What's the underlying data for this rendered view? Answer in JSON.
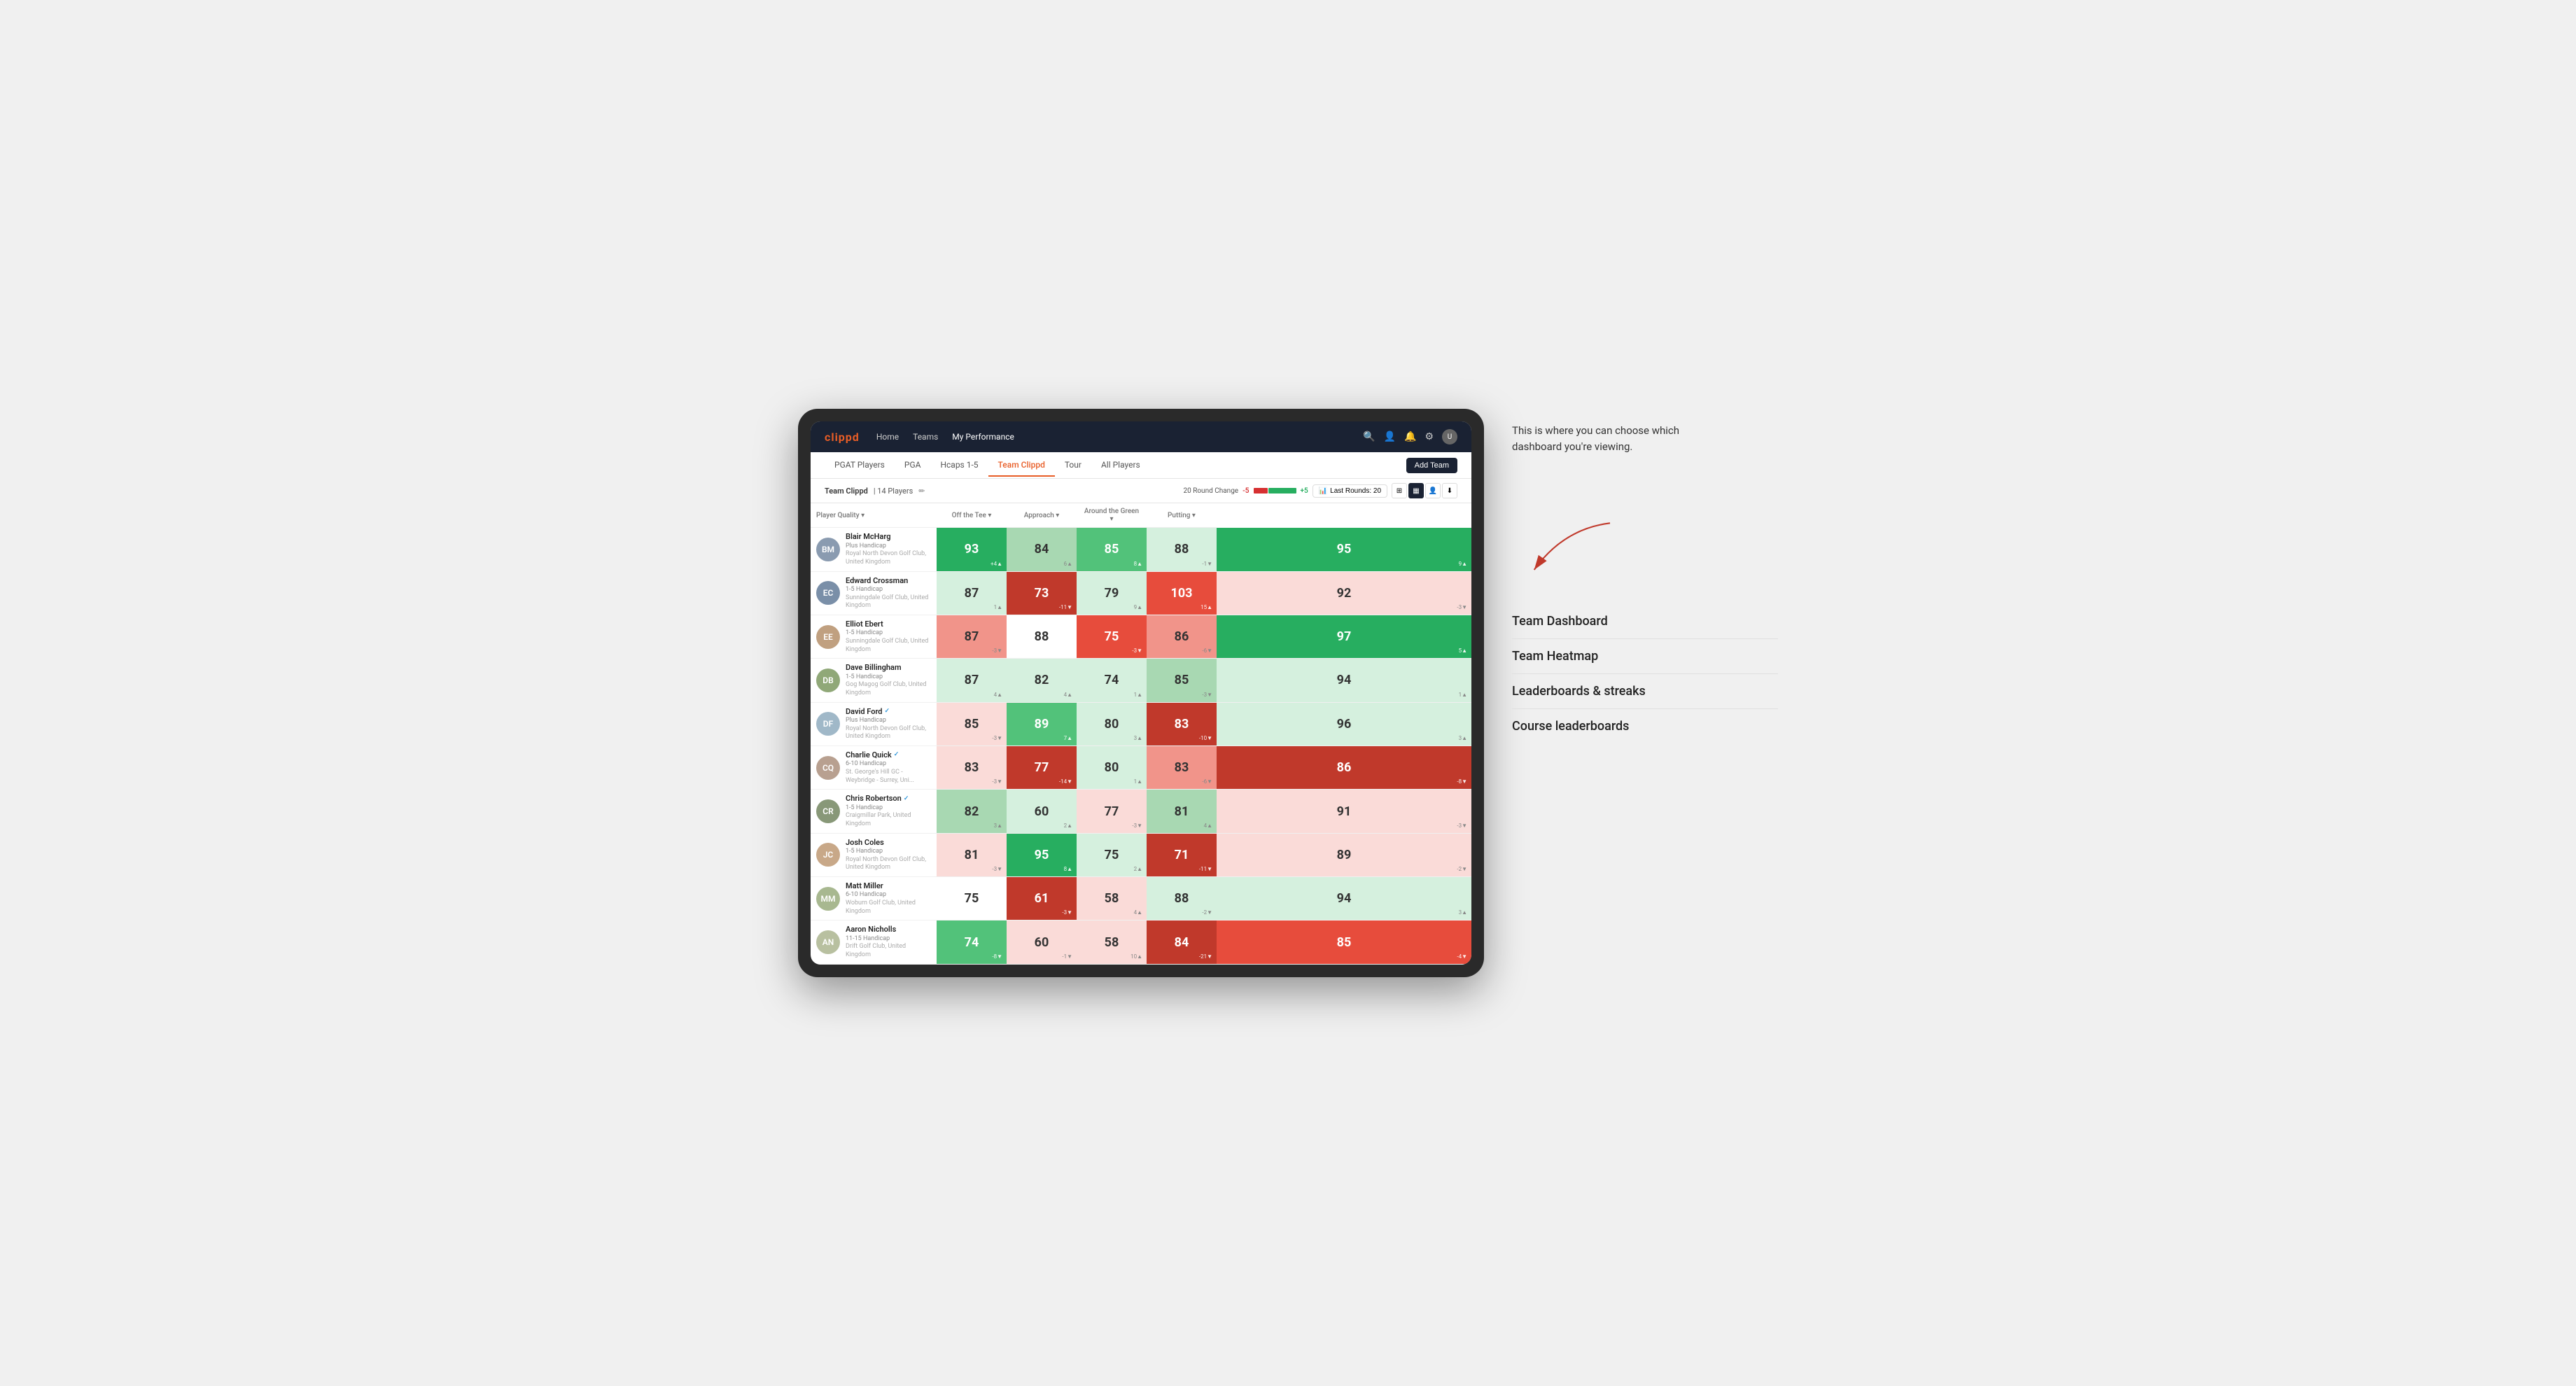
{
  "annotation": {
    "text": "This is where you can choose which dashboard you're viewing.",
    "arrow_label": "arrow pointing to view selector"
  },
  "menu": {
    "items": [
      {
        "id": "team-dashboard",
        "label": "Team Dashboard"
      },
      {
        "id": "team-heatmap",
        "label": "Team Heatmap"
      },
      {
        "id": "leaderboards",
        "label": "Leaderboards & streaks"
      },
      {
        "id": "course-leaderboards",
        "label": "Course leaderboards"
      }
    ]
  },
  "nav": {
    "logo": "clippd",
    "links": [
      {
        "label": "Home",
        "active": false
      },
      {
        "label": "Teams",
        "active": false
      },
      {
        "label": "My Performance",
        "active": true
      }
    ],
    "icons": [
      "search",
      "person",
      "bell",
      "settings",
      "avatar"
    ]
  },
  "sub_nav": {
    "tabs": [
      {
        "label": "PGAT Players",
        "active": false
      },
      {
        "label": "PGA",
        "active": false
      },
      {
        "label": "Hcaps 1-5",
        "active": false
      },
      {
        "label": "Team Clippd",
        "active": true
      },
      {
        "label": "Tour",
        "active": false
      },
      {
        "label": "All Players",
        "active": false
      }
    ],
    "add_team_label": "Add Team"
  },
  "team_bar": {
    "team_name": "Team Clippd",
    "player_count": "14 Players",
    "round_change_label": "20 Round Change",
    "change_neg": "-5",
    "change_pos": "+5",
    "last_rounds_label": "Last Rounds:",
    "last_rounds_value": "20",
    "view_modes": [
      "grid",
      "heatmap",
      "person",
      "download"
    ]
  },
  "table": {
    "col_headers": [
      {
        "label": "Player Quality ▾",
        "key": "quality"
      },
      {
        "label": "Off the Tee ▾",
        "key": "tee"
      },
      {
        "label": "Approach ▾",
        "key": "approach"
      },
      {
        "label": "Around the Green ▾",
        "key": "green"
      },
      {
        "label": "Putting ▾",
        "key": "putting"
      }
    ],
    "players": [
      {
        "name": "Blair McHarg",
        "hcp": "Plus Handicap",
        "club": "Royal North Devon Golf Club, United Kingdom",
        "initials": "BM",
        "avatar_color": "#8a9bb0",
        "verified": false,
        "scores": [
          {
            "value": 93,
            "change": "+4",
            "dir": "up",
            "bg": "green-dark"
          },
          {
            "value": 84,
            "change": "6",
            "dir": "up",
            "bg": "green-light"
          },
          {
            "value": 85,
            "change": "8",
            "dir": "up",
            "bg": "green-mid"
          },
          {
            "value": 88,
            "change": "-1",
            "dir": "down",
            "bg": "pale-green"
          },
          {
            "value": 95,
            "change": "9",
            "dir": "up",
            "bg": "green-dark"
          }
        ]
      },
      {
        "name": "Edward Crossman",
        "hcp": "1-5 Handicap",
        "club": "Sunningdale Golf Club, United Kingdom",
        "initials": "EC",
        "avatar_color": "#7a8fa8",
        "verified": false,
        "scores": [
          {
            "value": 87,
            "change": "1",
            "dir": "up",
            "bg": "pale-green"
          },
          {
            "value": 73,
            "change": "-11",
            "dir": "down",
            "bg": "red-dark"
          },
          {
            "value": 79,
            "change": "9",
            "dir": "up",
            "bg": "pale-green"
          },
          {
            "value": 103,
            "change": "15",
            "dir": "up",
            "bg": "red-mid"
          },
          {
            "value": 92,
            "change": "-3",
            "dir": "down",
            "bg": "pale-red"
          }
        ]
      },
      {
        "name": "Elliot Ebert",
        "hcp": "1-5 Handicap",
        "club": "Sunningdale Golf Club, United Kingdom",
        "initials": "EE",
        "avatar_color": "#c0a080",
        "verified": false,
        "scores": [
          {
            "value": 87,
            "change": "-3",
            "dir": "down",
            "bg": "red-light"
          },
          {
            "value": 88,
            "change": "",
            "dir": "",
            "bg": "white"
          },
          {
            "value": 75,
            "change": "-3",
            "dir": "down",
            "bg": "red-mid"
          },
          {
            "value": 86,
            "change": "-6",
            "dir": "down",
            "bg": "red-light"
          },
          {
            "value": 97,
            "change": "5",
            "dir": "up",
            "bg": "green-dark"
          }
        ]
      },
      {
        "name": "Dave Billingham",
        "hcp": "1-5 Handicap",
        "club": "Gog Magog Golf Club, United Kingdom",
        "initials": "DB",
        "avatar_color": "#90a878",
        "verified": false,
        "scores": [
          {
            "value": 87,
            "change": "4",
            "dir": "up",
            "bg": "pale-green"
          },
          {
            "value": 82,
            "change": "4",
            "dir": "up",
            "bg": "pale-green"
          },
          {
            "value": 74,
            "change": "1",
            "dir": "up",
            "bg": "pale-green"
          },
          {
            "value": 85,
            "change": "-3",
            "dir": "down",
            "bg": "green-light"
          },
          {
            "value": 94,
            "change": "1",
            "dir": "up",
            "bg": "pale-green"
          }
        ]
      },
      {
        "name": "David Ford",
        "hcp": "Plus Handicap",
        "club": "Royal North Devon Golf Club, United Kingdom",
        "initials": "DF",
        "avatar_color": "#a0b8c8",
        "verified": true,
        "scores": [
          {
            "value": 85,
            "change": "-3",
            "dir": "down",
            "bg": "pale-red"
          },
          {
            "value": 89,
            "change": "7",
            "dir": "up",
            "bg": "green-mid"
          },
          {
            "value": 80,
            "change": "3",
            "dir": "up",
            "bg": "pale-green"
          },
          {
            "value": 83,
            "change": "-10",
            "dir": "down",
            "bg": "red-dark"
          },
          {
            "value": 96,
            "change": "3",
            "dir": "up",
            "bg": "pale-green"
          }
        ]
      },
      {
        "name": "Charlie Quick",
        "hcp": "6-10 Handicap",
        "club": "St. George's Hill GC - Weybridge - Surrey, Uni...",
        "initials": "CQ",
        "avatar_color": "#b8a090",
        "verified": true,
        "scores": [
          {
            "value": 83,
            "change": "-3",
            "dir": "down",
            "bg": "pale-red"
          },
          {
            "value": 77,
            "change": "-14",
            "dir": "down",
            "bg": "red-dark"
          },
          {
            "value": 80,
            "change": "1",
            "dir": "up",
            "bg": "pale-green"
          },
          {
            "value": 83,
            "change": "-6",
            "dir": "down",
            "bg": "red-light"
          },
          {
            "value": 86,
            "change": "-8",
            "dir": "down",
            "bg": "red-dark"
          }
        ]
      },
      {
        "name": "Chris Robertson",
        "hcp": "1-5 Handicap",
        "club": "Craigmillar Park, United Kingdom",
        "initials": "CR",
        "avatar_color": "#889878",
        "verified": true,
        "scores": [
          {
            "value": 82,
            "change": "3",
            "dir": "up",
            "bg": "green-light"
          },
          {
            "value": 60,
            "change": "2",
            "dir": "up",
            "bg": "pale-green"
          },
          {
            "value": 77,
            "change": "-3",
            "dir": "down",
            "bg": "pale-red"
          },
          {
            "value": 81,
            "change": "4",
            "dir": "up",
            "bg": "green-light"
          },
          {
            "value": 91,
            "change": "-3",
            "dir": "down",
            "bg": "pale-red"
          }
        ]
      },
      {
        "name": "Josh Coles",
        "hcp": "1-5 Handicap",
        "club": "Royal North Devon Golf Club, United Kingdom",
        "initials": "JC",
        "avatar_color": "#c8a888",
        "verified": false,
        "scores": [
          {
            "value": 81,
            "change": "-3",
            "dir": "down",
            "bg": "pale-red"
          },
          {
            "value": 95,
            "change": "8",
            "dir": "up",
            "bg": "green-dark"
          },
          {
            "value": 75,
            "change": "2",
            "dir": "up",
            "bg": "pale-green"
          },
          {
            "value": 71,
            "change": "-11",
            "dir": "down",
            "bg": "red-dark"
          },
          {
            "value": 89,
            "change": "-2",
            "dir": "down",
            "bg": "pale-red"
          }
        ]
      },
      {
        "name": "Matt Miller",
        "hcp": "6-10 Handicap",
        "club": "Woburn Golf Club, United Kingdom",
        "initials": "MM",
        "avatar_color": "#a8b890",
        "verified": false,
        "scores": [
          {
            "value": 75,
            "change": "",
            "dir": "",
            "bg": "white"
          },
          {
            "value": 61,
            "change": "-3",
            "dir": "down",
            "bg": "red-dark"
          },
          {
            "value": 58,
            "change": "4",
            "dir": "up",
            "bg": "pale-red"
          },
          {
            "value": 88,
            "change": "-2",
            "dir": "down",
            "bg": "pale-green"
          },
          {
            "value": 94,
            "change": "3",
            "dir": "up",
            "bg": "pale-green"
          }
        ]
      },
      {
        "name": "Aaron Nicholls",
        "hcp": "11-15 Handicap",
        "club": "Drift Golf Club, United Kingdom",
        "initials": "AN",
        "avatar_color": "#b8c0a0",
        "verified": false,
        "scores": [
          {
            "value": 74,
            "change": "-8",
            "dir": "down",
            "bg": "green-mid"
          },
          {
            "value": 60,
            "change": "-1",
            "dir": "down",
            "bg": "pale-red"
          },
          {
            "value": 58,
            "change": "10",
            "dir": "up",
            "bg": "pale-red"
          },
          {
            "value": 84,
            "change": "-21",
            "dir": "down",
            "bg": "red-dark"
          },
          {
            "value": 85,
            "change": "-4",
            "dir": "down",
            "bg": "red-mid"
          }
        ]
      }
    ]
  }
}
